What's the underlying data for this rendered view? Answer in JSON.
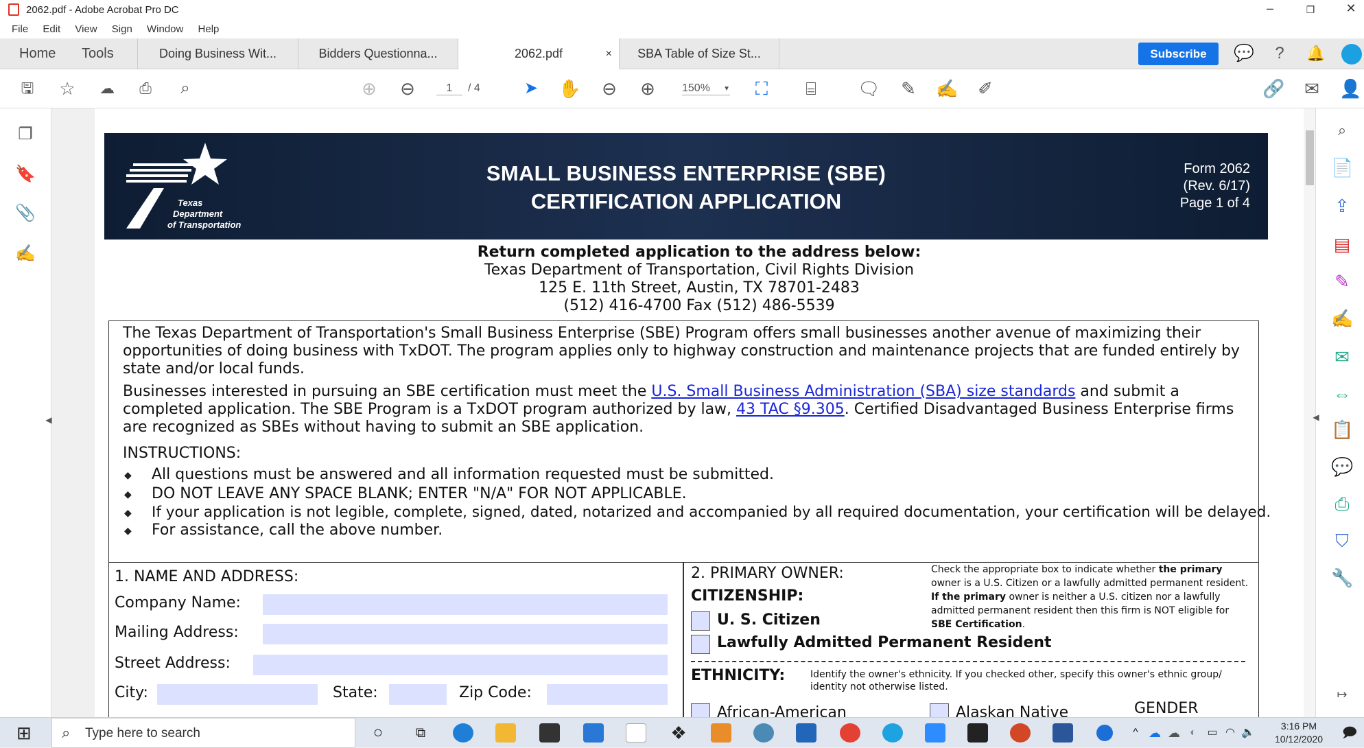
{
  "window": {
    "title": "2062.pdf - Adobe Acrobat Pro DC"
  },
  "menu": [
    "File",
    "Edit",
    "View",
    "Sign",
    "Window",
    "Help"
  ],
  "nav": {
    "home": "Home",
    "tools": "Tools"
  },
  "tabs": [
    {
      "label": "Doing Business Wit..."
    },
    {
      "label": "Bidders Questionna..."
    },
    {
      "label": "2062.pdf",
      "close": "×"
    },
    {
      "label": "SBA Table of Size St..."
    }
  ],
  "subscribe_label": "Subscribe",
  "toolbar": {
    "page_current": "1",
    "page_total": "/ 4",
    "zoom": "150%"
  },
  "document": {
    "banner": {
      "line1": "SMALL BUSINESS ENTERPRISE (SBE)",
      "line2": "CERTIFICATION APPLICATION",
      "form": "Form 2062",
      "rev": "(Rev. 6/17)",
      "page": "Page 1 of 4",
      "logo_l1": "Texas",
      "logo_l2": "Department",
      "logo_l3": "of Transportation"
    },
    "return_heading": "Return completed application to the address below:",
    "addr1": "Texas Department of Transportation, Civil Rights Division",
    "addr2": "125 E. 11th Street, Austin, TX 78701-2483",
    "addr3": "(512) 416-4700 Fax (512) 486-5539",
    "intro": "The Texas Department of Transportation's Small Business Enterprise (SBE) Program offers small businesses another avenue of maximizing their opportunities of doing business with TxDOT. The program applies only to highway construction and maintenance projects that are funded entirely by state and/or local funds.",
    "p2_a": "Businesses interested in pursuing an SBE certification must meet the ",
    "p2_link1": "U.S. Small Business Administration (SBA) size standards",
    "p2_b": " and submit a completed application. The SBE Program is a TxDOT program authorized by law, ",
    "p2_link2": "43 TAC §9.305",
    "p2_c": ". Certified Disadvantaged Business Enterprise firms are recognized as SBEs without having to submit an SBE application.",
    "instructions": "INSTRUCTIONS:",
    "bullets": [
      "All questions must be answered and all information requested must be submitted.",
      "DO NOT LEAVE ANY SPACE BLANK; ENTER \"N/A\" FOR NOT APPLICABLE.",
      "If your application is not legible, complete, signed, dated, notarized and accompanied by all required documentation, your certification will be delayed.",
      "For assistance, call the above number."
    ],
    "s1": {
      "title": "1. NAME AND ADDRESS:",
      "company": "Company Name:",
      "mailing": "Mailing Address:",
      "street": "Street Address:",
      "city": "City:",
      "state": "State:",
      "zip": "Zip Code:"
    },
    "s2": {
      "title": "2. PRIMARY OWNER:",
      "citizenship": "CITIZENSHIP:",
      "us": "U. S. Citizen",
      "lapr": "Lawfully Admitted Permanent Resident",
      "ethnicity": "ETHNICITY:",
      "eth_note": "Identify the owner's ethnicity. If you checked other, specify this owner's ethnic group/ identity not otherwise listed.",
      "african": "African-American",
      "alaskan": "Alaskan Native",
      "gender": "GENDER",
      "note_a": "Check the appropriate box to indicate whether ",
      "note_b": "the primary",
      "note_c": " owner is a U.S. Citizen or a lawfully admitted permanent resident. ",
      "note_d": "If the primary",
      "note_e": " owner is neither a U.S. citizen nor a lawfully admitted permanent resident then this firm is NOT eligible for ",
      "note_f": "SBE Certification",
      "note_g": "."
    }
  },
  "taskbar": {
    "search_placeholder": "Type here to search",
    "time": "3:16 PM",
    "date": "10/12/2020"
  }
}
